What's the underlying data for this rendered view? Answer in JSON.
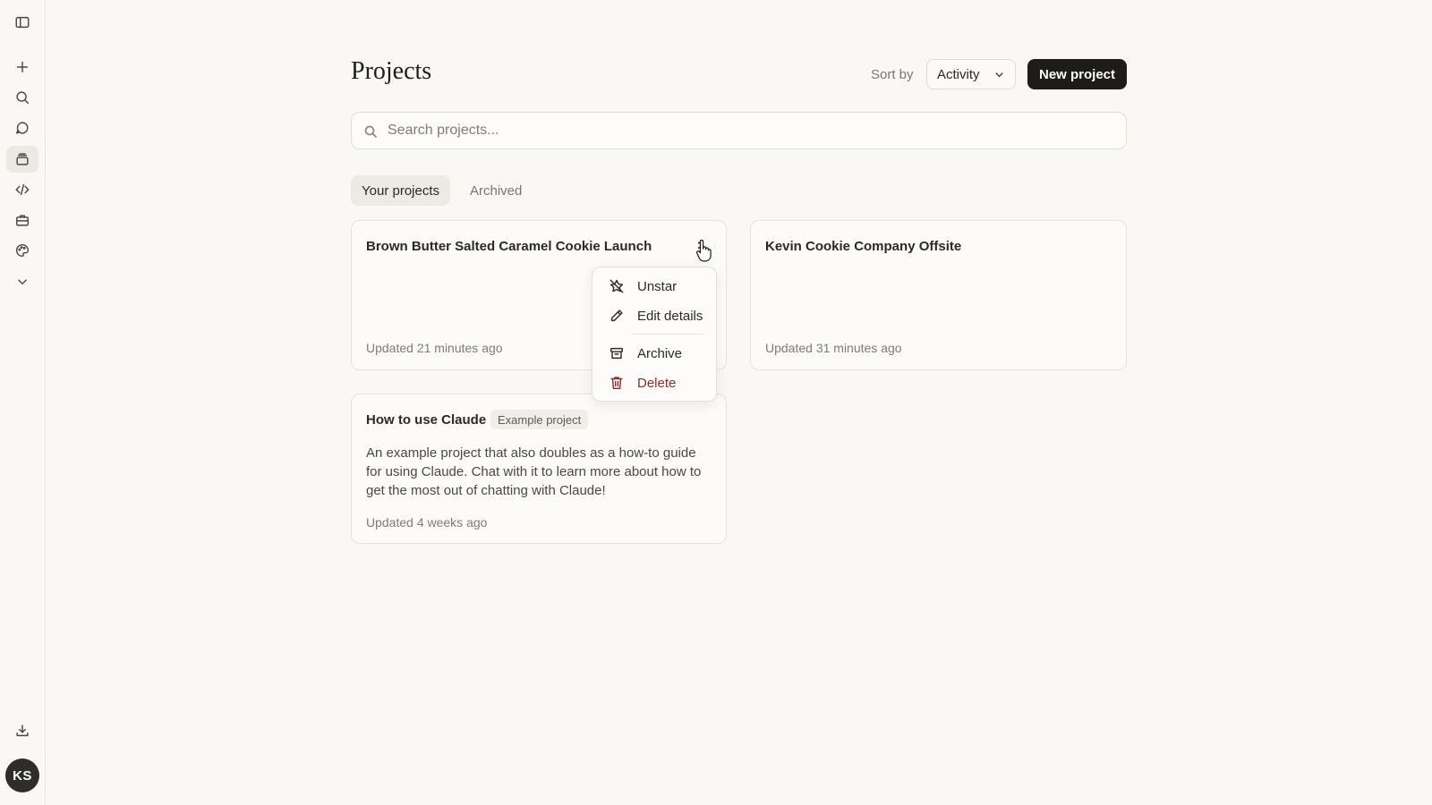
{
  "sidebar": {
    "items": [
      {
        "name": "sidebar-toggle-icon"
      },
      {
        "name": "new-chat-icon"
      },
      {
        "name": "search-icon"
      },
      {
        "name": "chats-icon"
      },
      {
        "name": "projects-icon"
      },
      {
        "name": "code-icon"
      },
      {
        "name": "artifacts-icon"
      },
      {
        "name": "palette-icon"
      },
      {
        "name": "chevron-down-icon"
      }
    ],
    "download_icon": "download-icon",
    "avatar_initials": "KS"
  },
  "header": {
    "title": "Projects",
    "sort_label": "Sort by",
    "sort_value": "Activity",
    "new_button": "New project"
  },
  "search": {
    "placeholder": "Search projects...",
    "value": ""
  },
  "tabs": [
    {
      "label": "Your projects",
      "active": true
    },
    {
      "label": "Archived",
      "active": false
    }
  ],
  "projects": [
    {
      "title": "Brown Butter Salted Caramel Cookie Launch",
      "updated": "Updated 21 minutes ago"
    },
    {
      "title": "Kevin Cookie Company Offsite",
      "updated": "Updated 31 minutes ago"
    },
    {
      "title": "How to use Claude",
      "badge": "Example project",
      "description": "An example project that also doubles as a how-to guide for using Claude. Chat with it to learn more about how to get the most out of chatting with Claude!",
      "updated": "Updated 4 weeks ago"
    }
  ],
  "menu": {
    "items": [
      {
        "label": "Unstar",
        "icon": "unstar-icon"
      },
      {
        "label": "Edit details",
        "icon": "pencil-icon"
      },
      {
        "label": "Archive",
        "icon": "archive-icon"
      },
      {
        "label": "Delete",
        "icon": "trash-icon",
        "color": "#8a2f2a"
      }
    ]
  },
  "colors": {
    "background": "#f9f8f5",
    "primary_button": "#1d1c1a",
    "danger": "#8a2f2a"
  }
}
